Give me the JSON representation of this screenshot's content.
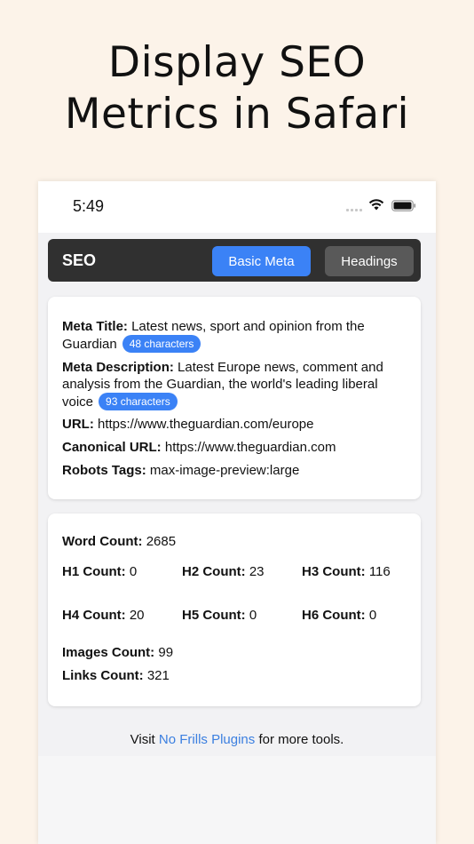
{
  "headline": {
    "line1": "Display SEO",
    "line2": "Metrics in Safari"
  },
  "status_bar": {
    "time": "5:49"
  },
  "nav": {
    "title": "SEO",
    "tabs": [
      {
        "label": "Basic Meta",
        "active": true
      },
      {
        "label": "Headings",
        "active": false
      }
    ]
  },
  "meta": {
    "title_label": "Meta Title:",
    "title_value_line1": "Latest news, sport and opinion from the",
    "title_value_line2": "Guardian",
    "title_chars": "48 characters",
    "description_label": "Meta Description:",
    "description_value_line1": "Latest Europe news, comment and",
    "description_value_line2": "analysis from the Guardian, the world's leading liberal",
    "description_value_line3": "voice",
    "description_chars": "93 characters",
    "url_label": "URL:",
    "url_value": "https://www.theguardian.com/europe",
    "canonical_label": "Canonical URL:",
    "canonical_value": "https://www.theguardian.com",
    "robots_label": "Robots Tags:",
    "robots_value": "max-image-preview:large"
  },
  "counts": {
    "word_label": "Word Count:",
    "word_value": "2685",
    "h1_label": "H1 Count:",
    "h1_value": "0",
    "h2_label": "H2 Count:",
    "h2_value": "23",
    "h3_label": "H3 Count:",
    "h3_value": "116",
    "h4_label": "H4 Count:",
    "h4_value": "20",
    "h5_label": "H5 Count:",
    "h5_value": "0",
    "h6_label": "H6 Count:",
    "h6_value": "0",
    "images_label": "Images Count:",
    "images_value": "99",
    "links_label": "Links Count:",
    "links_value": "321"
  },
  "footer": {
    "prefix": "Visit",
    "link_text": "No Frills Plugins",
    "suffix": "for more tools."
  },
  "colors": {
    "accent": "#3b82f6",
    "nav_bg": "#303030",
    "inactive_tab": "#595959",
    "page_bg": "#fcf3e9",
    "link": "#3b7fe0"
  },
  "icons": [
    "signal-icon",
    "wifi-icon",
    "battery-icon"
  ]
}
